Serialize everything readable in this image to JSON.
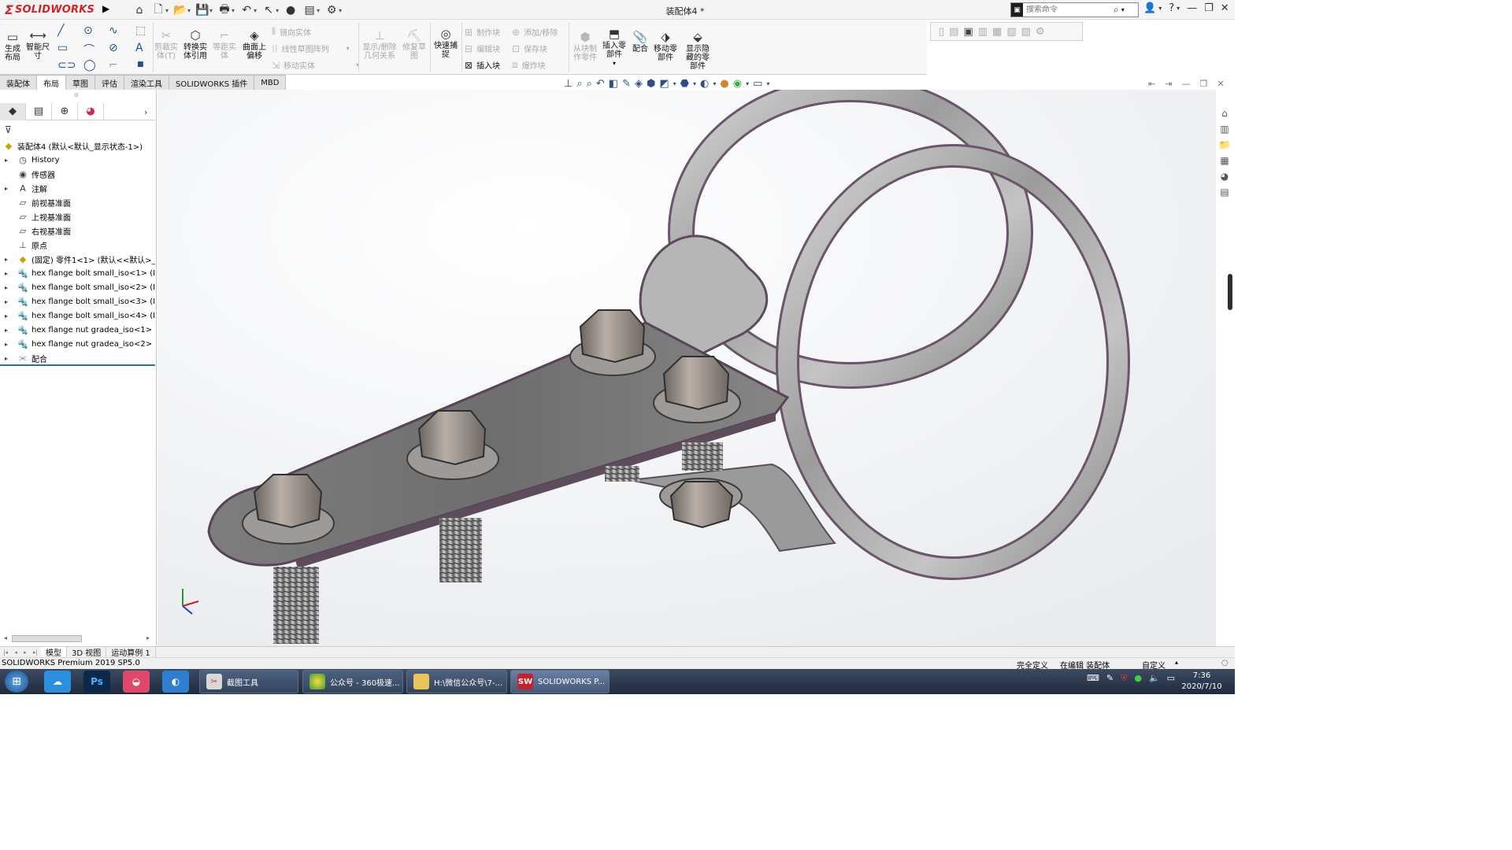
{
  "app": {
    "logo_ds": "ƻ",
    "logo_text": "SOLIDWORKS",
    "title": "装配体4 *",
    "search_placeholder": "搜索命令"
  },
  "ribbon": {
    "groups": [
      {
        "key": "gen_layout",
        "label": "生成\n布局",
        "enabled": true
      },
      {
        "key": "smart_dim",
        "label": "智能尺\n寸",
        "enabled": true
      },
      {
        "key": "trim",
        "label": "剪裁实\n体(T)",
        "enabled": false
      },
      {
        "key": "convert",
        "label": "转换实\n体引用",
        "enabled": true
      },
      {
        "key": "offset",
        "label": "等距实\n体",
        "enabled": false
      },
      {
        "key": "surface_offset",
        "label": "曲面上\n偏移",
        "enabled": true
      },
      {
        "key": "mirror",
        "label": "镜向实体",
        "enabled": false
      },
      {
        "key": "linear_pattern",
        "label": "线性草图阵列",
        "enabled": false
      },
      {
        "key": "move",
        "label": "移动实体",
        "enabled": false
      },
      {
        "key": "show_relations",
        "label": "显示/删除\n几何关系",
        "enabled": false
      },
      {
        "key": "repair",
        "label": "修复草\n图",
        "enabled": false
      },
      {
        "key": "quick_snap",
        "label": "快速捕\n捉",
        "enabled": true
      },
      {
        "key": "make_block",
        "label": "制作块",
        "enabled": false
      },
      {
        "key": "edit_block",
        "label": "编辑块",
        "enabled": false
      },
      {
        "key": "insert_block",
        "label": "插入块",
        "enabled": true
      },
      {
        "key": "add_remove",
        "label": "添加/移除",
        "enabled": false
      },
      {
        "key": "save_block",
        "label": "保存块",
        "enabled": false
      },
      {
        "key": "explode_block",
        "label": "爆炸块",
        "enabled": false
      },
      {
        "key": "make_part",
        "label": "从块制\n作零件",
        "enabled": false
      },
      {
        "key": "insert_part",
        "label": "插入零\n部件",
        "enabled": true
      },
      {
        "key": "mate",
        "label": "配合",
        "enabled": true
      },
      {
        "key": "move_part",
        "label": "移动零\n部件",
        "enabled": true
      },
      {
        "key": "show_hidden",
        "label": "显示隐\n藏的零\n部件",
        "enabled": true
      }
    ]
  },
  "tabs": [
    {
      "label": "装配体",
      "active": false
    },
    {
      "label": "布局",
      "active": true
    },
    {
      "label": "草图",
      "active": false
    },
    {
      "label": "评估",
      "active": false
    },
    {
      "label": "渲染工具",
      "active": false
    },
    {
      "label": "SOLIDWORKS 插件",
      "active": false
    },
    {
      "label": "MBD",
      "active": false
    }
  ],
  "tree": {
    "root": "装配体4  (默认<默认_显示状态-1>)",
    "items": [
      {
        "label": "History",
        "icon": "history-icon",
        "expandable": true
      },
      {
        "label": "传感器",
        "icon": "sensor-icon",
        "expandable": false
      },
      {
        "label": "注解",
        "icon": "annotation-icon",
        "expandable": true
      },
      {
        "label": "前视基准面",
        "icon": "plane-icon",
        "expandable": false
      },
      {
        "label": "上视基准面",
        "icon": "plane-icon",
        "expandable": false
      },
      {
        "label": "右视基准面",
        "icon": "plane-icon",
        "expandable": false
      },
      {
        "label": "原点",
        "icon": "origin-icon",
        "expandable": false
      },
      {
        "label": "(固定) 零件1<1> (默认<<默认>_显",
        "icon": "part-icon",
        "expandable": true
      },
      {
        "label": "hex flange bolt small_iso<1> (ISO",
        "icon": "bolt-icon",
        "expandable": true
      },
      {
        "label": "hex flange bolt small_iso<2> (ISO",
        "icon": "bolt-icon",
        "expandable": true
      },
      {
        "label": "hex flange bolt small_iso<3> (ISO",
        "icon": "bolt-icon",
        "expandable": true
      },
      {
        "label": "hex flange bolt small_iso<4> (ISO",
        "icon": "bolt-icon",
        "expandable": true
      },
      {
        "label": "hex flange nut gradea_iso<1> (IS",
        "icon": "bolt-icon",
        "expandable": true
      },
      {
        "label": "hex flange nut gradea_iso<2> (IS",
        "icon": "bolt-icon",
        "expandable": true
      },
      {
        "label": "配合",
        "icon": "mates-icon",
        "expandable": true
      }
    ]
  },
  "bottom_tabs": [
    {
      "label": "模型",
      "active": true
    },
    {
      "label": "3D 视图",
      "active": false
    },
    {
      "label": "运动算例 1",
      "active": false
    }
  ],
  "status": {
    "product": "SOLIDWORKS Premium 2019 SP5.0",
    "defined": "完全定义",
    "editing": "在编辑 装配体",
    "units": "自定义"
  },
  "taskbar": {
    "tasks": [
      {
        "label": "截图工具",
        "icon": "scissors-icon"
      },
      {
        "label": "公众号 - 360极速...",
        "icon": "browser-icon"
      },
      {
        "label": "H:\\微信公众号\\7-...",
        "icon": "folder-icon"
      },
      {
        "label": "SOLIDWORKS P...",
        "icon": "solidworks-icon"
      }
    ],
    "time": "7:36",
    "date": "2020/7/10"
  },
  "colors": {
    "brand": "#d2232a",
    "tree_accent": "#2f6db5",
    "metal": "#b0b0b0",
    "edge_purple": "#7a5f7a"
  }
}
